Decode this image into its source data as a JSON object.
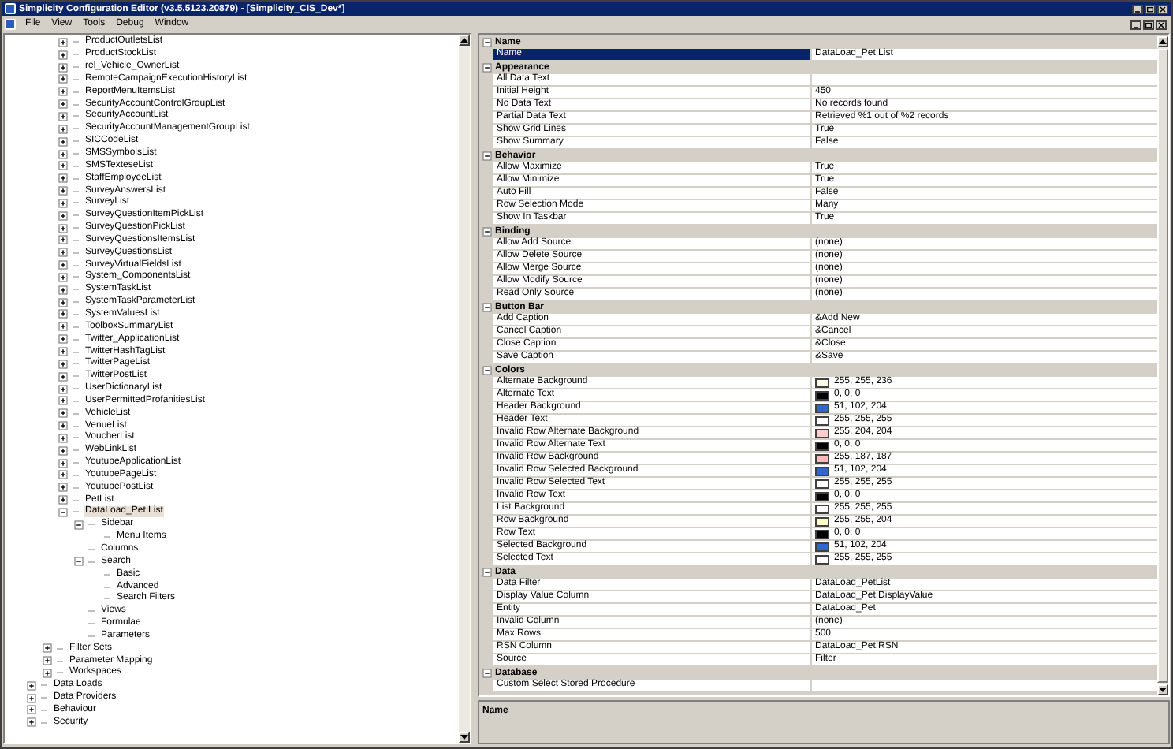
{
  "window": {
    "title": "Simplicity Configuration Editor (v3.5.5123.20879) - [Simplicity_CIS_Dev*]"
  },
  "menu": [
    "File",
    "View",
    "Tools",
    "Debug",
    "Window"
  ],
  "tree": [
    {
      "children": [
        {
          "children": [
            {
              "label": "ProductOutletsList",
              "expanded": false,
              "selected": false
            },
            {
              "label": "ProductStockList",
              "expanded": false,
              "selected": false
            },
            {
              "label": "rel_Vehicle_OwnerList",
              "expanded": false,
              "selected": false
            },
            {
              "label": "RemoteCampaignExecutionHistoryList",
              "expanded": false,
              "selected": false
            },
            {
              "label": "ReportMenuItemsList",
              "expanded": false,
              "selected": false
            },
            {
              "label": "SecurityAccountControlGroupList",
              "expanded": false,
              "selected": false
            },
            {
              "label": "SecurityAccountList",
              "expanded": false,
              "selected": false
            },
            {
              "label": "SecurityAccountManagementGroupList",
              "expanded": false,
              "selected": false
            },
            {
              "label": "SICCodeList",
              "expanded": false,
              "selected": false
            },
            {
              "label": "SMSSymbolsList",
              "expanded": false,
              "selected": false
            },
            {
              "label": "SMSTexteseList",
              "expanded": false,
              "selected": false
            },
            {
              "label": "StaffEmployeeList",
              "expanded": false,
              "selected": false
            },
            {
              "label": "SurveyAnswersList",
              "expanded": false,
              "selected": false
            },
            {
              "label": "SurveyList",
              "expanded": false,
              "selected": false
            },
            {
              "label": "SurveyQuestionItemPickList",
              "expanded": false,
              "selected": false
            },
            {
              "label": "SurveyQuestionPickList",
              "expanded": false,
              "selected": false
            },
            {
              "label": "SurveyQuestionsItemsList",
              "expanded": false,
              "selected": false
            },
            {
              "label": "SurveyQuestionsList",
              "expanded": false,
              "selected": false
            },
            {
              "label": "SurveyVirtualFieldsList",
              "expanded": false,
              "selected": false
            },
            {
              "label": "System_ComponentsList",
              "expanded": false,
              "selected": false
            },
            {
              "label": "SystemTaskList",
              "expanded": false,
              "selected": false
            },
            {
              "label": "SystemTaskParameterList",
              "expanded": false,
              "selected": false
            },
            {
              "label": "SystemValuesList",
              "expanded": false,
              "selected": false
            },
            {
              "label": "ToolboxSummaryList",
              "expanded": false,
              "selected": false
            },
            {
              "label": "Twitter_ApplicationList",
              "expanded": false,
              "selected": false
            },
            {
              "label": "TwitterHashTagList",
              "expanded": false,
              "selected": false
            },
            {
              "label": "TwitterPageList",
              "expanded": false,
              "selected": false
            },
            {
              "label": "TwitterPostList",
              "expanded": false,
              "selected": false
            },
            {
              "label": "UserDictionaryList",
              "expanded": false,
              "selected": false
            },
            {
              "label": "UserPermittedProfanitiesList",
              "expanded": false,
              "selected": false
            },
            {
              "label": "VehicleList",
              "expanded": false,
              "selected": false
            },
            {
              "label": "VenueList",
              "expanded": false,
              "selected": false
            },
            {
              "label": "VoucherList",
              "expanded": false,
              "selected": false
            },
            {
              "label": "WebLinkList",
              "expanded": false,
              "selected": false
            },
            {
              "label": "YoutubeApplicationList",
              "expanded": false,
              "selected": false
            },
            {
              "label": "YoutubePageList",
              "expanded": false,
              "selected": false
            },
            {
              "label": "YoutubePostList",
              "expanded": false,
              "selected": false
            },
            {
              "label": "PetList",
              "expanded": false,
              "selected": false
            },
            {
              "label": "DataLoad_Pet List",
              "expanded": true,
              "selected": true,
              "children": [
                {
                  "label": "Sidebar",
                  "expanded": true,
                  "selected": false,
                  "children": [
                    {
                      "label": "Menu Items",
                      "selected": false
                    }
                  ]
                },
                {
                  "label": "Columns",
                  "selected": false
                },
                {
                  "label": "Search",
                  "expanded": true,
                  "selected": false,
                  "children": [
                    {
                      "label": "Basic",
                      "selected": false
                    },
                    {
                      "label": "Advanced",
                      "selected": false
                    },
                    {
                      "label": "Search Filters",
                      "selected": false
                    }
                  ]
                },
                {
                  "label": "Views",
                  "selected": false
                },
                {
                  "label": "Formulae",
                  "selected": false
                },
                {
                  "label": "Parameters",
                  "selected": false
                }
              ]
            }
          ]
        },
        {
          "label": "Filter Sets",
          "expanded": false,
          "selected": false
        },
        {
          "label": "Parameter Mapping",
          "expanded": false,
          "selected": false
        },
        {
          "label": "Workspaces",
          "expanded": false,
          "selected": false
        }
      ]
    },
    {
      "label": "Data Loads",
      "expanded": false,
      "selected": false
    },
    {
      "label": "Data Providers",
      "expanded": false,
      "selected": false
    },
    {
      "label": "Behaviour",
      "expanded": false,
      "selected": false
    },
    {
      "label": "Security",
      "expanded": false,
      "selected": false
    }
  ],
  "grid": {
    "sections": [
      {
        "title": "Name",
        "expanded": true,
        "rows": [
          {
            "kind": "text",
            "name": "Name",
            "value": "DataLoad_Pet List",
            "selected": true
          }
        ]
      },
      {
        "title": "Appearance",
        "expanded": true,
        "rows": [
          {
            "kind": "text",
            "name": "All Data Text",
            "selected": false
          },
          {
            "kind": "text",
            "name": "Initial Height",
            "value": "450",
            "selected": false
          },
          {
            "kind": "text",
            "name": "No Data Text",
            "value": "No records found",
            "selected": false
          },
          {
            "kind": "text",
            "name": "Partial Data Text",
            "value": "Retrieved %1 out of %2 records",
            "selected": false
          },
          {
            "kind": "text",
            "name": "Show Grid Lines",
            "value": "True",
            "selected": false
          },
          {
            "kind": "text",
            "name": "Show Summary",
            "value": "False",
            "selected": false
          }
        ]
      },
      {
        "title": "Behavior",
        "expanded": true,
        "rows": [
          {
            "kind": "text",
            "name": "Allow Maximize",
            "value": "True",
            "selected": false
          },
          {
            "kind": "text",
            "name": "Allow Minimize",
            "value": "True",
            "selected": false
          },
          {
            "kind": "text",
            "name": "Auto Fill",
            "value": "False",
            "selected": false
          },
          {
            "kind": "text",
            "name": "Row Selection Mode",
            "value": "Many",
            "selected": false
          },
          {
            "kind": "text",
            "name": "Show In Taskbar",
            "value": "True",
            "selected": false
          }
        ]
      },
      {
        "title": "Binding",
        "expanded": true,
        "rows": [
          {
            "kind": "text",
            "name": "Allow Add Source",
            "value": "(none)",
            "selected": false
          },
          {
            "kind": "text",
            "name": "Allow Delete Source",
            "value": "(none)",
            "selected": false
          },
          {
            "kind": "text",
            "name": "Allow Merge Source",
            "value": "(none)",
            "selected": false
          },
          {
            "kind": "text",
            "name": "Allow Modify Source",
            "value": "(none)",
            "selected": false
          },
          {
            "kind": "text",
            "name": "Read Only Source",
            "value": "(none)",
            "selected": false
          }
        ]
      },
      {
        "title": "Button Bar",
        "expanded": true,
        "rows": [
          {
            "kind": "text",
            "name": "Add Caption",
            "value": "&Add New",
            "selected": false
          },
          {
            "kind": "text",
            "name": "Cancel Caption",
            "value": "&Cancel",
            "selected": false
          },
          {
            "kind": "text",
            "name": "Close Caption",
            "value": "&Close",
            "selected": false
          },
          {
            "kind": "text",
            "name": "Save Caption",
            "value": "&Save",
            "selected": false
          }
        ]
      },
      {
        "title": "Colors",
        "expanded": true,
        "rows": [
          {
            "kind": "color",
            "name": "Alternate Background",
            "value": "255, 255, 236",
            "color": "#ffffec",
            "selected": false
          },
          {
            "kind": "color",
            "name": "Alternate Text",
            "value": "0, 0, 0",
            "color": "#000000",
            "selected": false
          },
          {
            "kind": "color",
            "name": "Header Background",
            "value": "51, 102, 204",
            "color": "#3366cc",
            "selected": false
          },
          {
            "kind": "color",
            "name": "Header Text",
            "value": "255, 255, 255",
            "color": "#ffffff",
            "selected": false
          },
          {
            "kind": "color",
            "name": "Invalid Row Alternate Background",
            "value": "255, 204, 204",
            "color": "#ffcccc",
            "selected": false
          },
          {
            "kind": "color",
            "name": "Invalid Row Alternate Text",
            "value": "0, 0, 0",
            "color": "#000000",
            "selected": false
          },
          {
            "kind": "color",
            "name": "Invalid Row Background",
            "value": "255, 187, 187",
            "color": "#ffbbbb",
            "selected": false
          },
          {
            "kind": "color",
            "name": "Invalid Row Selected Background",
            "value": "51, 102, 204",
            "color": "#3366cc",
            "selected": false
          },
          {
            "kind": "color",
            "name": "Invalid Row Selected Text",
            "value": "255, 255, 255",
            "color": "#ffffff",
            "selected": false
          },
          {
            "kind": "color",
            "name": "Invalid Row Text",
            "value": "0, 0, 0",
            "color": "#000000",
            "selected": false
          },
          {
            "kind": "color",
            "name": "List Background",
            "value": "255, 255, 255",
            "color": "#ffffff",
            "selected": false
          },
          {
            "kind": "color",
            "name": "Row Background",
            "value": "255, 255, 204",
            "color": "#ffffcc",
            "selected": false
          },
          {
            "kind": "color",
            "name": "Row Text",
            "value": "0, 0, 0",
            "color": "#000000",
            "selected": false
          },
          {
            "kind": "color",
            "name": "Selected Background",
            "value": "51, 102, 204",
            "color": "#3366cc",
            "selected": false
          },
          {
            "kind": "color",
            "name": "Selected Text",
            "value": "255, 255, 255",
            "color": "#ffffff",
            "selected": false
          }
        ]
      },
      {
        "title": "Data",
        "expanded": true,
        "rows": [
          {
            "kind": "text",
            "name": "Data Filter",
            "value": "DataLoad_PetList",
            "selected": false
          },
          {
            "kind": "text",
            "name": "Display Value Column",
            "value": "DataLoad_Pet.DisplayValue",
            "selected": false
          },
          {
            "kind": "text",
            "name": "Entity",
            "value": "DataLoad_Pet",
            "selected": false
          },
          {
            "kind": "text",
            "name": "Invalid Column",
            "value": "(none)",
            "selected": false
          },
          {
            "kind": "text",
            "name": "Max Rows",
            "value": "500",
            "selected": false
          },
          {
            "kind": "text",
            "name": "RSN Column",
            "value": "DataLoad_Pet.RSN",
            "selected": false
          },
          {
            "kind": "text",
            "name": "Source",
            "value": "Filter",
            "selected": false
          }
        ]
      },
      {
        "title": "Database",
        "expanded": true,
        "rows": [
          {
            "kind": "text",
            "name": "Custom Select Stored Procedure",
            "selected": false
          }
        ]
      }
    ]
  },
  "description": {
    "title": "Name"
  }
}
